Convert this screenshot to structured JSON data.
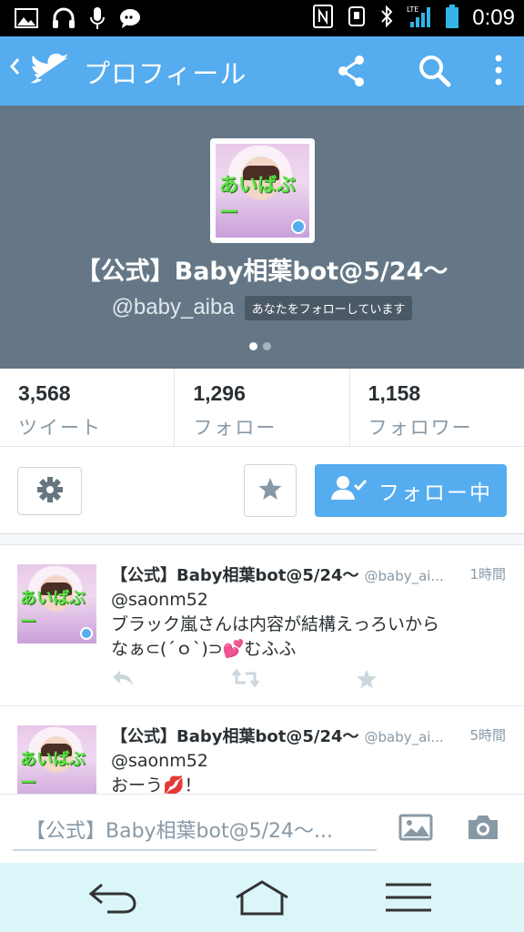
{
  "status_bar": {
    "time": "0:09",
    "left_icons": [
      "image-icon",
      "headphones-icon",
      "mic-icon",
      "chat-bubble-icon"
    ],
    "right_icons": [
      "nfc-icon",
      "usb-icon",
      "bluetooth-icon",
      "lte-signal-icon",
      "battery-icon"
    ]
  },
  "app_bar": {
    "title": "プロフィール",
    "color": "#55acee",
    "icons": [
      "back-chevron-icon",
      "twitter-bird-icon",
      "share-icon",
      "search-icon",
      "overflow-menu-icon"
    ]
  },
  "profile": {
    "avatar_text": "あいばぶー",
    "name": "【公式】Baby相葉bot@5/24〜",
    "handle": "@baby_aiba",
    "follows_you": "あなたをフォローしています",
    "header_color": "#657786"
  },
  "stats": [
    {
      "value": "3,568",
      "label": "ツイート"
    },
    {
      "value": "1,296",
      "label": "フォロー"
    },
    {
      "value": "1,158",
      "label": "フォロワー"
    }
  ],
  "actions": {
    "follow_label": "フォロー中"
  },
  "tweets": [
    {
      "name": "【公式】Baby相葉bot@5/24〜",
      "handle": "@baby_ai...",
      "time": "1時間",
      "avatar_text": "あいばぶー",
      "line1": "@saonm52",
      "line2": "ブラック嵐さんは内容が結構えっろいから",
      "line3": "なぁ⊂(´ｏ`)⊃💕むふふ"
    },
    {
      "name": "【公式】Baby相葉bot@5/24〜",
      "handle": "@baby_ai...",
      "time": "5時間",
      "avatar_text": "あいばぶー",
      "line1": "@saonm52",
      "line2": "おーう💋！"
    }
  ],
  "reply_bar": {
    "placeholder": "【公式】Baby相葉bot@5/24〜..."
  }
}
